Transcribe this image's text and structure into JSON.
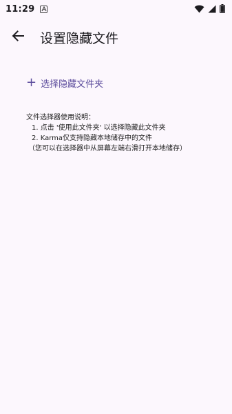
{
  "status_bar": {
    "time": "11:29",
    "icons": [
      "notification-a-icon",
      "wifi-icon",
      "cellular-signal-icon",
      "battery-icon"
    ]
  },
  "app_bar": {
    "back_icon": "arrow-back-icon",
    "title": "设置隐藏文件"
  },
  "select_folder": {
    "icon": "plus-icon",
    "label": "选择隐藏文件夹"
  },
  "instructions": {
    "heading": "文件选择器使用说明：",
    "items": [
      "1. 点击 '使用此文件夹' 以选择隐藏此文件夹",
      "2. Karma仅支持隐藏本地储存中的文件",
      "（您可以在选择器中从屏幕左端右滑打开本地储存）"
    ]
  },
  "colors": {
    "background": "#fcf7fd",
    "accent": "#5b4b9c",
    "text": "#1c1b1f"
  }
}
